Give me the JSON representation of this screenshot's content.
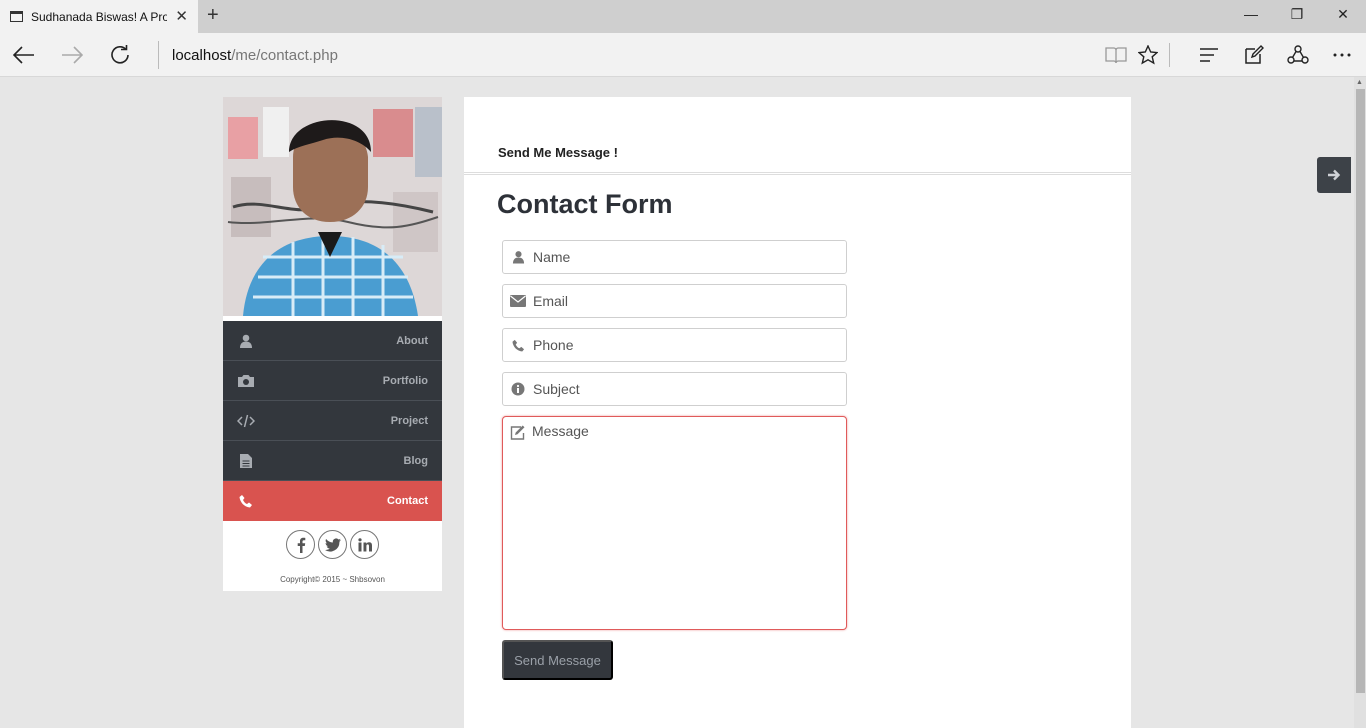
{
  "browser": {
    "tab_title": "Sudhanada Biswas! A Pro",
    "new_tab_icon": "plus-icon",
    "address_host": "localhost",
    "address_path": "/me/contact.php",
    "toolbar_icons": [
      "reading-view-icon",
      "favorite-star-icon",
      "hub-icon",
      "web-note-icon",
      "share-icon",
      "more-icon"
    ]
  },
  "sidebar": {
    "menu": [
      {
        "label": "About",
        "icon": "user-icon",
        "active": false
      },
      {
        "label": "Portfolio",
        "icon": "camera-icon",
        "active": false
      },
      {
        "label": "Project",
        "icon": "code-icon",
        "active": false
      },
      {
        "label": "Blog",
        "icon": "document-icon",
        "active": false
      },
      {
        "label": "Contact",
        "icon": "phone-icon",
        "active": true
      }
    ],
    "social": [
      "facebook-icon",
      "twitter-icon",
      "linkedin-icon"
    ],
    "copyright": "Copyright© 2015 ~ Shbsovon",
    "active_color": "#d9534f",
    "menu_color": "#33373d"
  },
  "main": {
    "heading": "Send Me Message !",
    "form_title": "Contact Form",
    "fields": {
      "name": {
        "placeholder": "Name",
        "value": ""
      },
      "email": {
        "placeholder": "Email",
        "value": ""
      },
      "phone": {
        "placeholder": "Phone",
        "value": ""
      },
      "subject": {
        "placeholder": "Subject",
        "value": ""
      },
      "message": {
        "placeholder": "Message",
        "value": ""
      }
    },
    "send_label": "Send Message"
  },
  "side_toggle_icon": "arrow-right-icon"
}
